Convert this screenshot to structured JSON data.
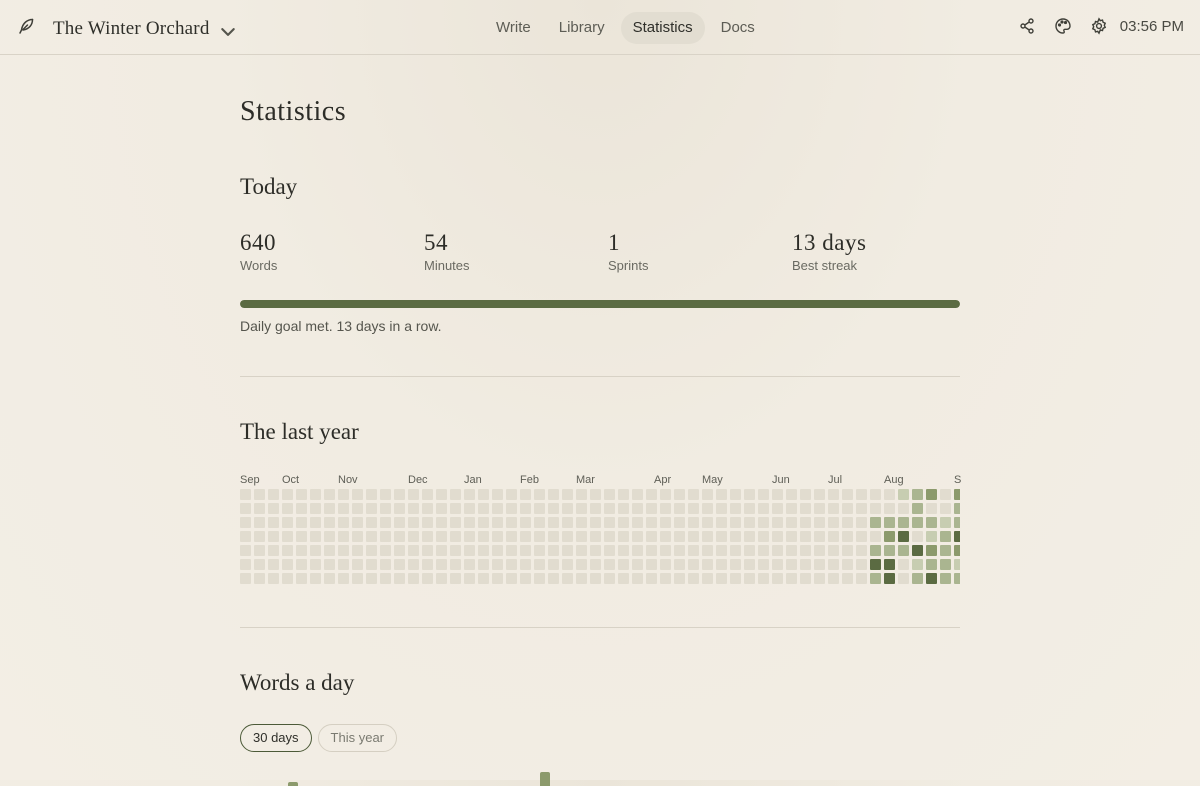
{
  "app": {
    "project_title": "The Winter Orchard",
    "brand_icon": "quill-icon"
  },
  "nav": {
    "items": [
      {
        "label": "Write",
        "active": false
      },
      {
        "label": "Library",
        "active": false
      },
      {
        "label": "Statistics",
        "active": true
      },
      {
        "label": "Docs",
        "active": false
      }
    ]
  },
  "topbar": {
    "icons": [
      "share-icon",
      "palette-icon",
      "gear-icon"
    ],
    "time": "03:56 PM"
  },
  "page": {
    "title": "Statistics"
  },
  "today": {
    "heading": "Today",
    "stats": [
      {
        "value": "640",
        "label": "Words"
      },
      {
        "value": "54",
        "label": "Minutes"
      },
      {
        "value": "1",
        "label": "Sprints"
      },
      {
        "value": "13 days",
        "label": "Best streak"
      }
    ],
    "goal_progress": 1.0,
    "goal_message": "Daily goal met. 13 days in a row."
  },
  "year": {
    "heading": "The last year",
    "months": [
      "Sep",
      "Oct",
      "Nov",
      "Dec",
      "Jan",
      "Feb",
      "Mar",
      "Apr",
      "May",
      "Jun",
      "Jul",
      "Aug",
      "S"
    ],
    "weeks_shown": 51,
    "active_weeks": [
      [
        0,
        0,
        2,
        0,
        2,
        4,
        2
      ],
      [
        0,
        0,
        2,
        3,
        2,
        4,
        4
      ],
      [
        1,
        0,
        2,
        4,
        2,
        0,
        0
      ],
      [
        2,
        2,
        2,
        0,
        4,
        1,
        2
      ],
      [
        3,
        0,
        2,
        1,
        3,
        2,
        4
      ],
      [
        0,
        0,
        1,
        2,
        2,
        2,
        2
      ],
      [
        3,
        2,
        2,
        4,
        3,
        1,
        2
      ]
    ],
    "colors": {
      "empty": "#e1dccf",
      "level1": "#c7cdb1",
      "level2": "#aab590",
      "level3": "#8c9a6c",
      "level4": "#5b6b42"
    }
  },
  "words": {
    "heading": "Words a day",
    "ranges": [
      {
        "label": "30 days",
        "active": true
      },
      {
        "label": "This year",
        "active": false
      }
    ],
    "bar_color": "#8c9a6c"
  }
}
